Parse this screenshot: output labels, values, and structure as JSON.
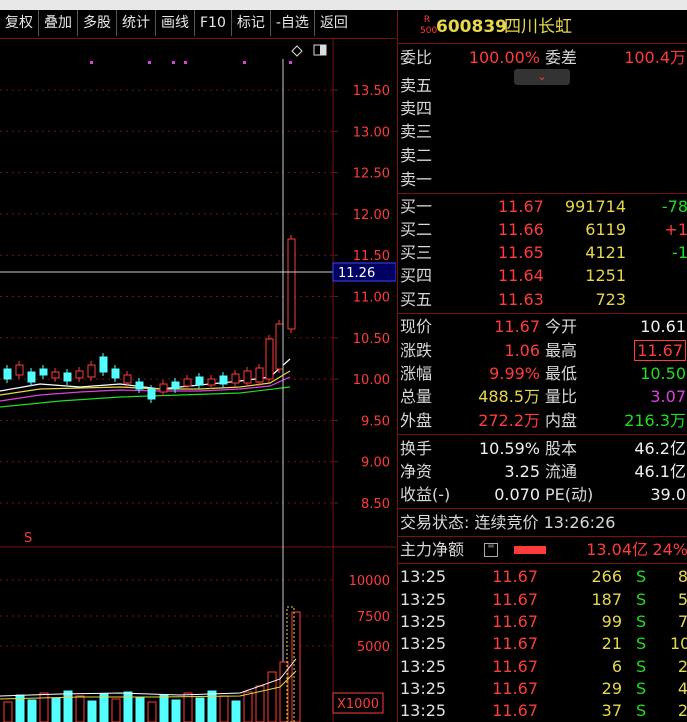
{
  "toolbar": [
    {
      "label": "复权",
      "name": "toolbar-fuquan-button"
    },
    {
      "label": "叠加",
      "name": "toolbar-diejia-button"
    },
    {
      "label": "多股",
      "name": "toolbar-duogu-button"
    },
    {
      "label": "统计",
      "name": "toolbar-tongji-button"
    },
    {
      "label": "画线",
      "name": "toolbar-huaxian-button"
    },
    {
      "label": "F10",
      "name": "toolbar-f10-button"
    },
    {
      "label": "标记",
      "name": "toolbar-biaoji-button"
    },
    {
      "label": "-自选",
      "name": "toolbar-zixuan-button"
    },
    {
      "label": "返回",
      "name": "toolbar-fanhui-button"
    }
  ],
  "chart": {
    "price_ticks": [
      "13.50",
      "13.00",
      "12.50",
      "12.00",
      "11.50",
      "11.00",
      "10.50",
      "10.00",
      "9.50",
      "9.00",
      "8.50"
    ],
    "crosshair_label": "11.26",
    "volume_ticks": [
      "10000",
      "7500",
      "5000"
    ],
    "volume_unit": "X1000",
    "s_marker": "S"
  },
  "stock": {
    "badge_top": "R",
    "badge_bottom": "500",
    "code": "600839",
    "name": "四川长虹"
  },
  "weibi": {
    "label": "委比",
    "value": "100.00%",
    "label2": "委差",
    "value2": "100.4万"
  },
  "sell": [
    {
      "label": "卖五"
    },
    {
      "label": "卖四"
    },
    {
      "label": "卖三"
    },
    {
      "label": "卖二"
    },
    {
      "label": "卖一"
    }
  ],
  "buy": [
    {
      "label": "买一",
      "price": "11.67",
      "vol": "991714",
      "chg": "-78"
    },
    {
      "label": "买二",
      "price": "11.66",
      "vol": "6119",
      "chg": "+1"
    },
    {
      "label": "买三",
      "price": "11.65",
      "vol": "4121",
      "chg": "-1"
    },
    {
      "label": "买四",
      "price": "11.64",
      "vol": "1251",
      "chg": ""
    },
    {
      "label": "买五",
      "price": "11.63",
      "vol": "723",
      "chg": ""
    }
  ],
  "quote": [
    {
      "l1": "现价",
      "v1": "11.67",
      "c1": "red",
      "l2": "今开",
      "v2": "10.61",
      "c2": "white"
    },
    {
      "l1": "涨跌",
      "v1": "1.06",
      "c1": "red",
      "l2": "最高",
      "v2": "11.67",
      "c2": "red"
    },
    {
      "l1": "涨幅",
      "v1": "9.99%",
      "c1": "red",
      "l2": "最低",
      "v2": "10.50",
      "c2": "green"
    },
    {
      "l1": "总量",
      "v1": "488.5万",
      "c1": "yellow",
      "l2": "量比",
      "v2": "3.07",
      "c2": "magenta"
    },
    {
      "l1": "外盘",
      "v1": "272.2万",
      "c1": "red",
      "l2": "内盘",
      "v2": "216.3万",
      "c2": "green"
    }
  ],
  "fund": [
    {
      "l1": "换手",
      "v1": "10.59%",
      "l2": "股本",
      "v2": "46.2亿"
    },
    {
      "l1": "净资",
      "v1": "3.25",
      "l2": "流通",
      "v2": "46.1亿"
    },
    {
      "l1": "收益(-)",
      "v1": "0.070",
      "l2": "PE(动)",
      "v2": "39.0"
    }
  ],
  "status": {
    "text": "交易状态: 连续竞价 13:26:26"
  },
  "mainflow": {
    "label": "主力净额",
    "value": "13.04亿",
    "pct": "24%"
  },
  "ticks": [
    {
      "time": "13:25",
      "price": "11.67",
      "vol": "266",
      "flag": "S",
      "n": "8"
    },
    {
      "time": "13:25",
      "price": "11.67",
      "vol": "187",
      "flag": "S",
      "n": "5"
    },
    {
      "time": "13:25",
      "price": "11.67",
      "vol": "99",
      "flag": "S",
      "n": "7"
    },
    {
      "time": "13:25",
      "price": "11.67",
      "vol": "21",
      "flag": "S",
      "n": "10"
    },
    {
      "time": "13:25",
      "price": "11.67",
      "vol": "6",
      "flag": "S",
      "n": "2"
    },
    {
      "time": "13:25",
      "price": "11.67",
      "vol": "29",
      "flag": "S",
      "n": "4"
    },
    {
      "time": "13:25",
      "price": "11.67",
      "vol": "37",
      "flag": "S",
      "n": "2"
    }
  ],
  "colors": {
    "up": "#ff3b3b",
    "down": "#22dd22",
    "vol": "#e6d84a",
    "border": "#7a1010",
    "candle_down": "#54ffff"
  }
}
